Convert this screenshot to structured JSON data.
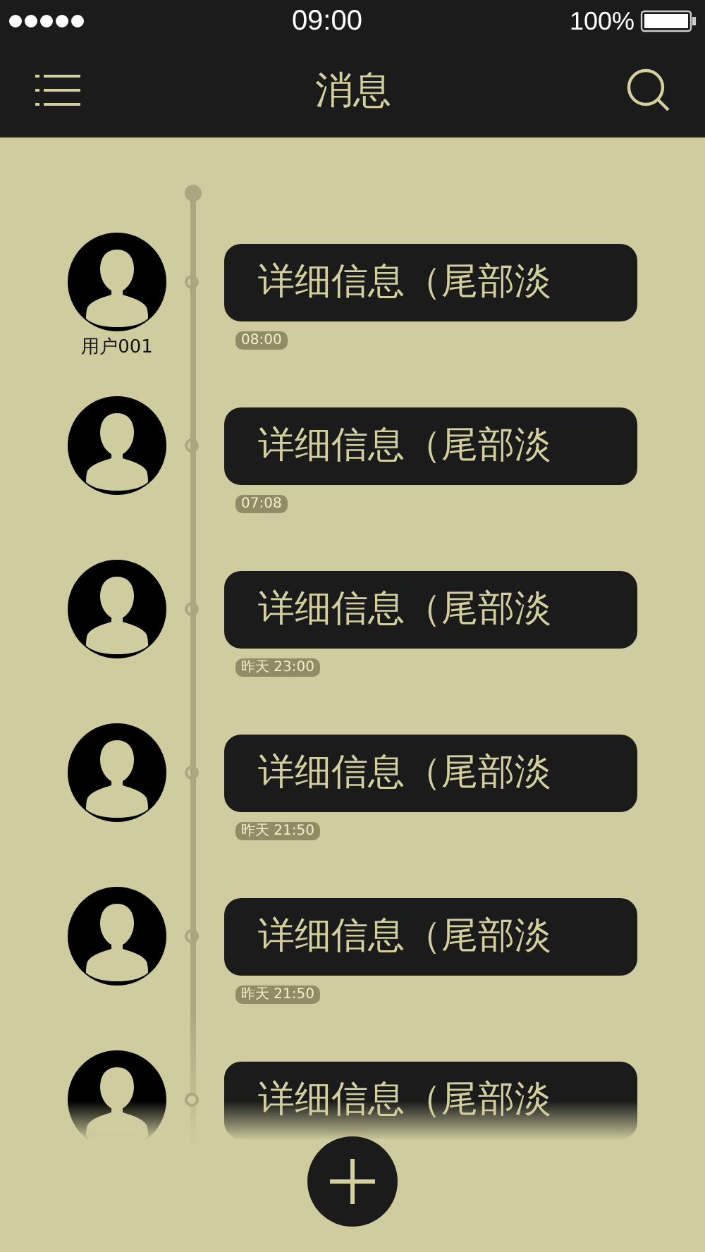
{
  "status_bar": {
    "time": "09:00",
    "battery": "100%"
  },
  "nav_bar": {
    "title": "消息"
  },
  "messages": [
    {
      "user": "用户001",
      "text": "详细信息（尾部淡",
      "time": "08:00",
      "faded": false
    },
    {
      "text": "详细信息（尾部淡",
      "time": "07:08",
      "faded": false
    },
    {
      "text": "详细信息（尾部淡",
      "time": "昨天 23:00",
      "faded": false
    },
    {
      "text": "详细信息（尾部淡",
      "time": "昨天 21:50",
      "faded": false
    },
    {
      "text": "详细信息（尾部淡",
      "time": "昨天 21:50",
      "faded": false
    },
    {
      "text": "详细信息（尾部淡",
      "faded": true
    }
  ]
}
